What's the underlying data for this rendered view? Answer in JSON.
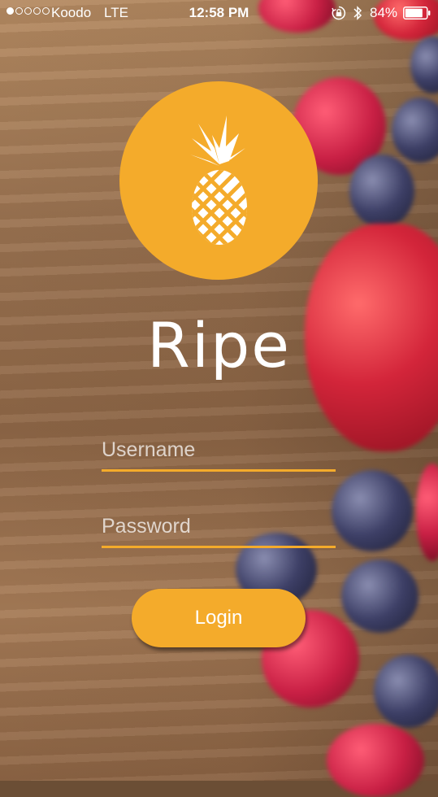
{
  "status_bar": {
    "carrier": "Koodo",
    "network": "LTE",
    "time": "12:58 PM",
    "battery_percent": "84%",
    "signal_strength_bars": 1,
    "signal_total_bars": 5,
    "icons": [
      "signal-dots-icon",
      "rotation-lock-icon",
      "bluetooth-icon",
      "battery-icon"
    ]
  },
  "app": {
    "name": "Ripe",
    "logo_icon": "pineapple-icon",
    "brand_color": "#f4ab2b"
  },
  "form": {
    "username_placeholder": "Username",
    "username_value": "",
    "password_placeholder": "Password",
    "password_value": "",
    "login_label": "Login"
  }
}
